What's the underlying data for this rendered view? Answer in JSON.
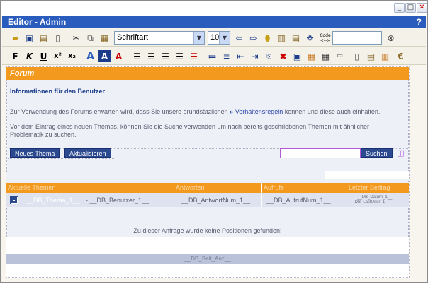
{
  "window": {
    "title": "Editor - Admin",
    "help": "?",
    "controls": {
      "minimize": "_",
      "maximize": "□",
      "close": "✕"
    }
  },
  "toolbar1": {
    "icons": [
      "new-document-icon",
      "save-icon",
      "save-all-icon",
      "page-icon",
      "cut-icon",
      "copy-icon",
      "paste-icon"
    ],
    "font_select": "Schriftart",
    "size_select": "10",
    "code_label": "Code",
    "code_arrows": "<-->"
  },
  "toolbar2": {
    "bold": "F",
    "italic": "K",
    "underline": "U",
    "superscript": "x²",
    "subscript": "x₂",
    "font_color": "A",
    "highlight": "A",
    "clear_format": "A"
  },
  "forum": {
    "header": "Forum",
    "info_title": "Informationen für den Benutzer",
    "para1_before": "Zur Verwendung des Forums erwarten wird, dass Sie unsere grundsätzlichen",
    "para1_link": "Verhaltensregeln",
    "para1_after": "kennen und diese auch einhalten.",
    "para2_line1": "Vor dem Eintrag eines neuen Themas, können Sie die Suche verwenden um nach bereits geschriebenen Themen mit ähnlicher",
    "para2_line2": "Problematik zu suchen.",
    "btn_new": "Neues Thema",
    "btn_refresh": "Aktualisieren",
    "btn_search": "Suchen",
    "search_value": ""
  },
  "table": {
    "headers": [
      "Aktuelle Themen",
      "Antworten",
      "Aufrufe",
      "Letzter Beitrag"
    ],
    "row": {
      "topic": "__DB_Thema_1__",
      "user": "- __DB_Benutzer_1__",
      "answers": "__DB_AntwortNum_1__",
      "views": "__DB_AufrufNum_1__",
      "last_date": "__DB_Datum_1__",
      "last_user": "__DB_LastUser_1__"
    },
    "empty_message": "Zu dieser Anfrage wurde keine Positionen gefunden!",
    "pager": "__DB_Seit_Anz__"
  },
  "colors": {
    "accent": "#f39a1e",
    "titlebar": "#2a5cbe",
    "button": "#2b4a8f"
  }
}
